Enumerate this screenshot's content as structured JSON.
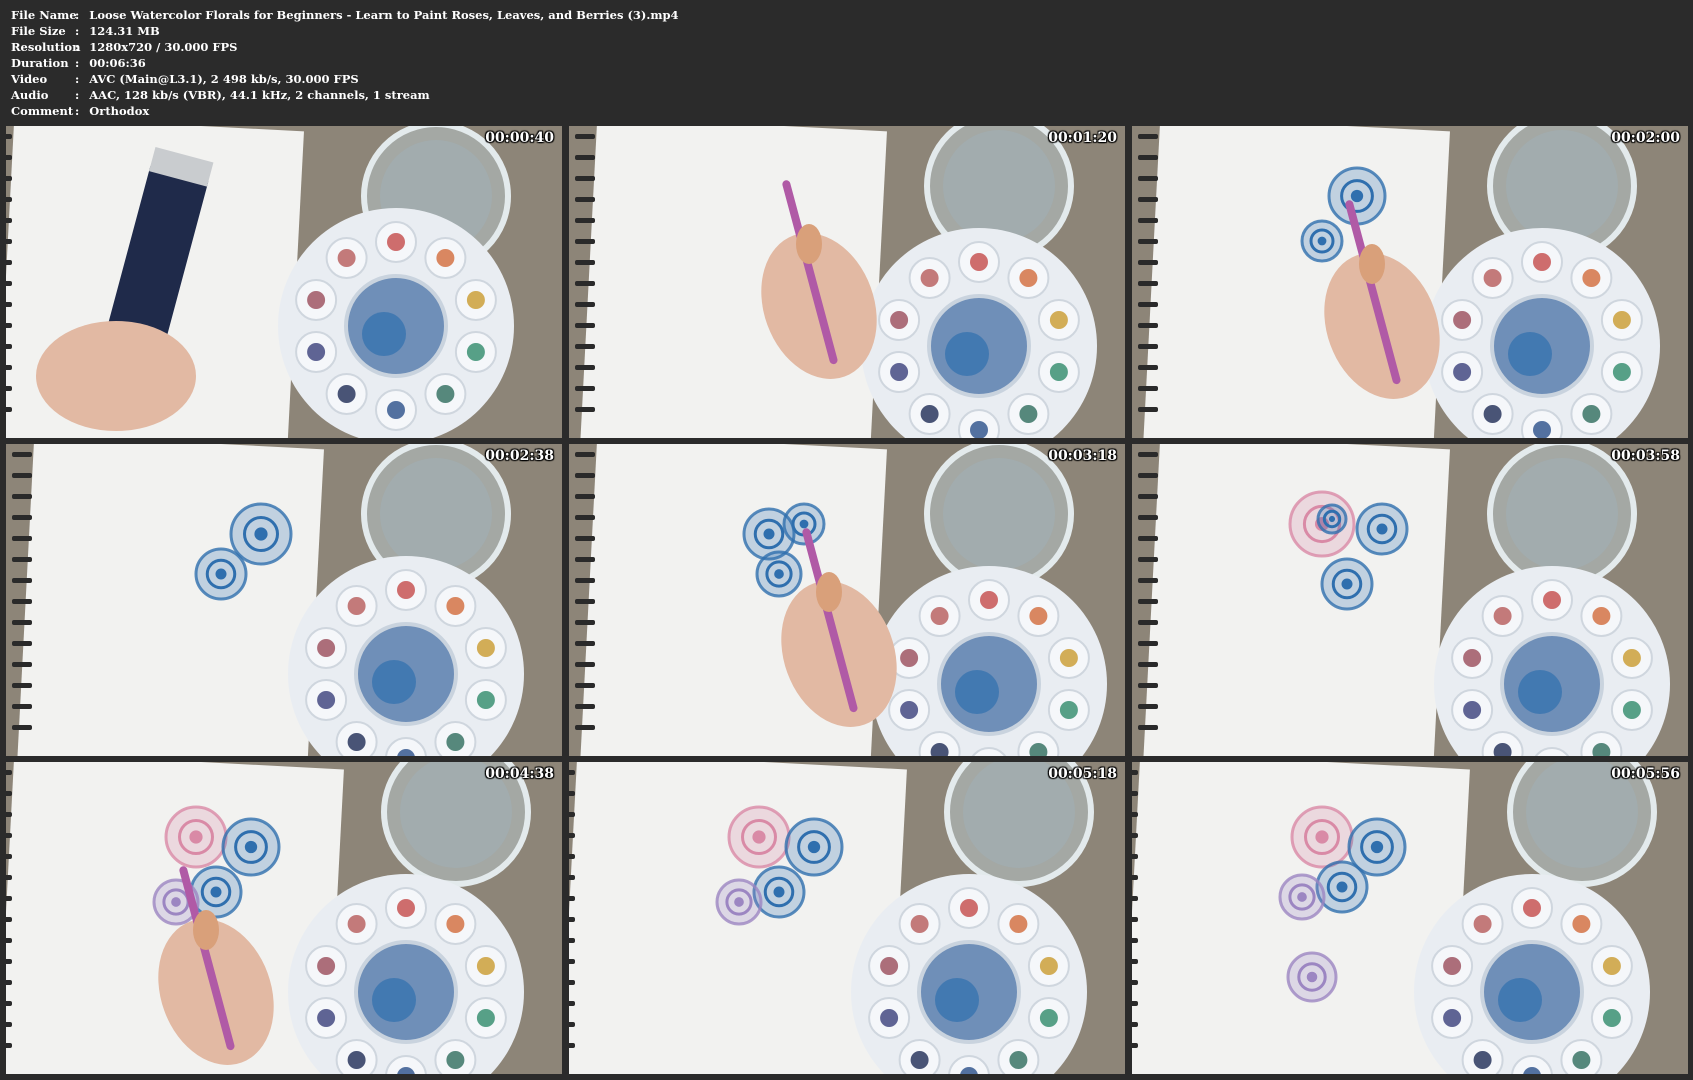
{
  "info": [
    {
      "key": "File Name",
      "value": "Loose Watercolor Florals for Beginners - Learn to Paint Roses, Leaves, and Berries (3).mp4"
    },
    {
      "key": "File Size",
      "value": "124.31 MB"
    },
    {
      "key": "Resolution",
      "value": "1280x720 / 30.000 FPS"
    },
    {
      "key": "Duration",
      "value": "00:06:36"
    },
    {
      "key": "Video",
      "value": "AVC (Main@L3.1), 2 498 kb/s, 30.000 FPS"
    },
    {
      "key": "Audio",
      "value": "AAC, 128 kb/s (VBR), 44.1 kHz, 2 channels, 1 stream"
    },
    {
      "key": "Comment",
      "value": "Orthodox"
    }
  ],
  "separator": ":",
  "thumbnails": [
    {
      "timestamp": "00:00:40",
      "scene": "paint-tube"
    },
    {
      "timestamp": "00:01:20",
      "scene": "brush-blank"
    },
    {
      "timestamp": "00:02:00",
      "scene": "two-blue-roses-brush"
    },
    {
      "timestamp": "00:02:38",
      "scene": "two-blue-roses"
    },
    {
      "timestamp": "00:03:18",
      "scene": "three-blue-roses-brush"
    },
    {
      "timestamp": "00:03:58",
      "scene": "pink-blue-cluster"
    },
    {
      "timestamp": "00:04:38",
      "scene": "cluster-purple-brush"
    },
    {
      "timestamp": "00:05:18",
      "scene": "cluster-purple"
    },
    {
      "timestamp": "00:05:56",
      "scene": "cluster-purple-single"
    }
  ],
  "colors": {
    "background": "#2b2b2b",
    "info_text": "#ffffff",
    "counter": "#8d8578",
    "paper": "#f2f2f0",
    "blue_paint": "#2f6fae",
    "pink_paint": "#d98aa6",
    "purple_paint": "#9c86c2",
    "palette": "#e9edf2"
  }
}
